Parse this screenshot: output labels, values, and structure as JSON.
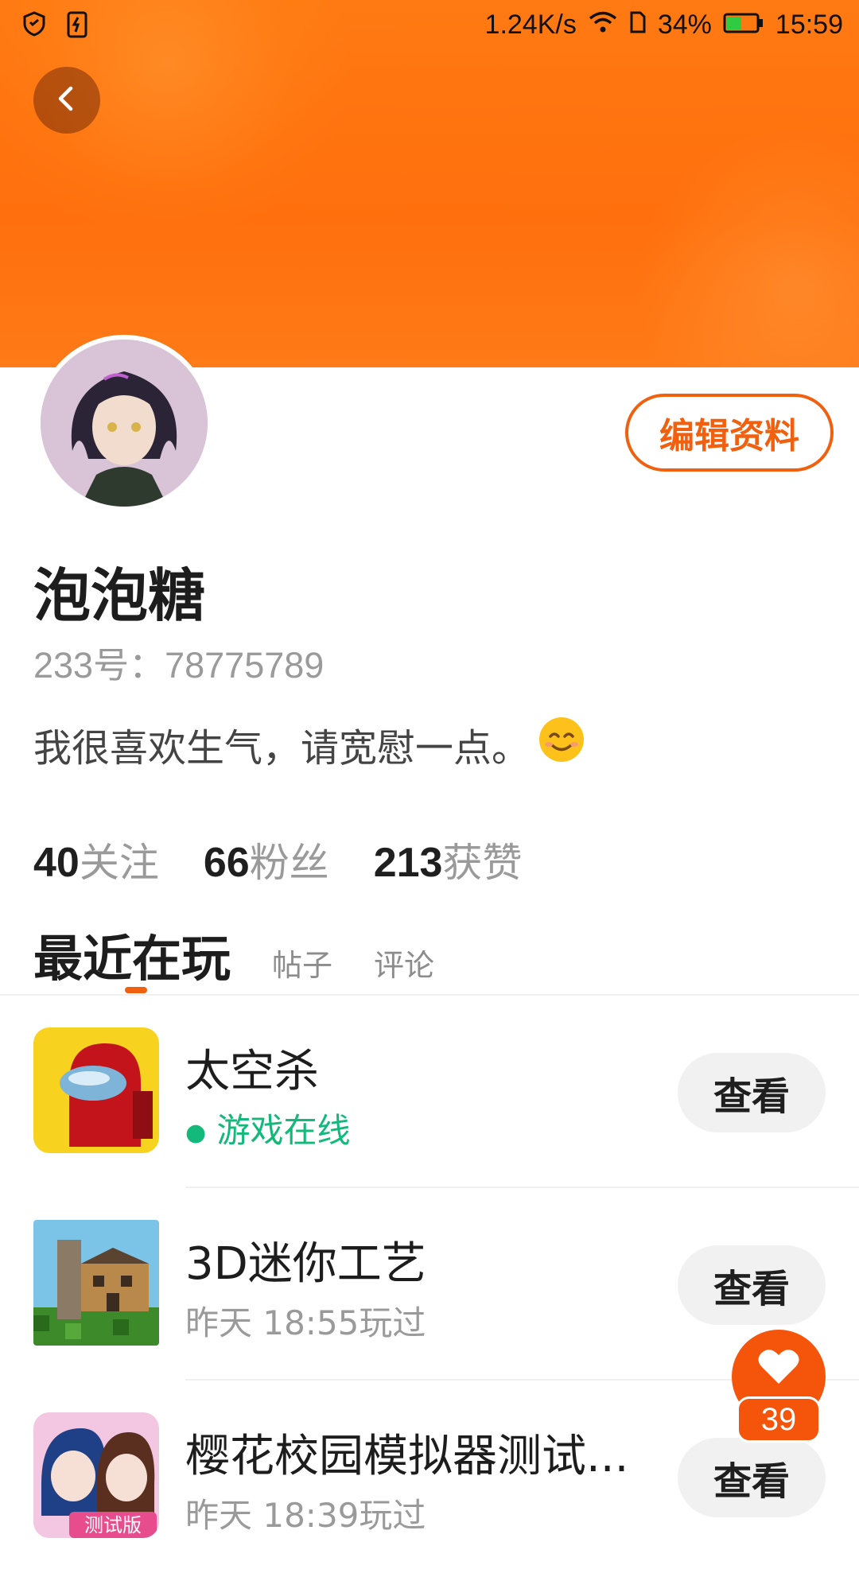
{
  "status_bar": {
    "network_speed": "1.24K/s",
    "battery": "34%",
    "time": "15:59"
  },
  "profile": {
    "edit_label": "编辑资料",
    "username": "泡泡糖",
    "user_id": "233号：78775789",
    "bio": "我很喜欢生气，请宽慰一点。"
  },
  "stats": [
    {
      "num": "40",
      "label": "关注"
    },
    {
      "num": "66",
      "label": "粉丝"
    },
    {
      "num": "213",
      "label": "获赞"
    }
  ],
  "tabs": {
    "active": "最近在玩",
    "posts": "帖子",
    "comments": "评论"
  },
  "games": [
    {
      "title": "太空杀",
      "subtitle": "游戏在线",
      "button": "查看"
    },
    {
      "title": "3D迷你工艺",
      "subtitle": "昨天 18:55玩过",
      "button": "查看"
    },
    {
      "title": "樱花校园模拟器测试...",
      "subtitle": "昨天 18:39玩过",
      "button": "查看",
      "badge": "测试版"
    }
  ],
  "like_fab": {
    "count": "39"
  },
  "colors": {
    "accent": "#f0600e",
    "online": "#12b97a"
  }
}
